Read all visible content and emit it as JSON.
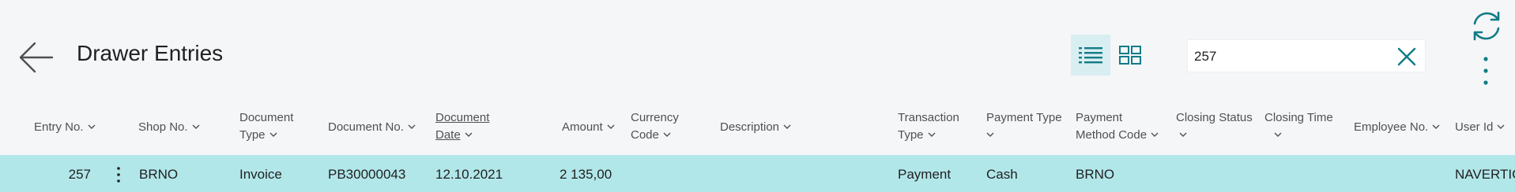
{
  "header": {
    "title": "Drawer Entries",
    "back_icon": "arrow-left-icon",
    "list_view_icon": "list-view-icon",
    "tile_view_icon": "tile-view-icon",
    "refresh_icon": "refresh-icon",
    "more_icon": "more-vertical-icon"
  },
  "search": {
    "value": "257",
    "clear_icon": "close-icon"
  },
  "columns": [
    {
      "line1": "Entry No.",
      "line2": ""
    },
    {
      "line1": "Shop No.",
      "line2": ""
    },
    {
      "line1": "Document",
      "line2": "Type"
    },
    {
      "line1": "Document No.",
      "line2": ""
    },
    {
      "line1": "Document",
      "line2": "Date"
    },
    {
      "line1": "Amount",
      "line2": ""
    },
    {
      "line1": "Currency",
      "line2": "Code"
    },
    {
      "line1": "Description",
      "line2": ""
    },
    {
      "line1": "Transaction",
      "line2": "Type"
    },
    {
      "line1": "Payment Type",
      "line2": ""
    },
    {
      "line1": "Payment",
      "line2": "Method Code"
    },
    {
      "line1": "Closing Status",
      "line2": ""
    },
    {
      "line1": "Closing Time",
      "line2": ""
    },
    {
      "line1": "Employee No.",
      "line2": ""
    },
    {
      "line1": "User Id",
      "line2": ""
    }
  ],
  "rows": [
    {
      "entry_no": "257",
      "shop_no": "BRNO",
      "document_type": "Invoice",
      "document_no": "PB30000043",
      "document_date": "12.10.2021",
      "amount": "2 135,00",
      "currency_code": "",
      "description": "",
      "transaction_type": "Payment",
      "payment_type": "Cash",
      "payment_method_code": "BRNO",
      "closing_status": "",
      "closing_time": "",
      "employee_no": "",
      "user_id": "NAVERTIC"
    }
  ],
  "colors": {
    "accent": "#107c87",
    "selected_row": "#b2e7ea",
    "active_toggle": "#d9eef1"
  }
}
